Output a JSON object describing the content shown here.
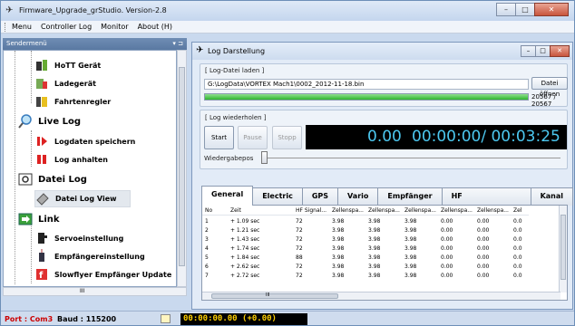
{
  "app": {
    "title": "Firmware_Upgrade_grStudio.  Version-2.8"
  },
  "window_buttons": {
    "minimize": "–",
    "maximize": "□",
    "close": "✕"
  },
  "menu": [
    "Menu",
    "Controller Log",
    "Monitor",
    "About (H)"
  ],
  "sidebar": {
    "header": "Sendermenü",
    "pin": "▾ ⊐",
    "items": [
      {
        "label": "HoTT Gerät",
        "icon": "hott-device-icon",
        "level": 2
      },
      {
        "label": "Ladegerät",
        "icon": "charger-icon",
        "level": 2
      },
      {
        "label": "Fahrtenregler",
        "icon": "speed-controller-icon",
        "level": 2
      },
      {
        "label": "Live Log",
        "icon": "magnifier-icon",
        "level": 1
      },
      {
        "label": "Logdaten speichern",
        "icon": "record-icon",
        "level": 2
      },
      {
        "label": "Log anhalten",
        "icon": "stop-icon",
        "level": 2
      },
      {
        "label": "Datei Log",
        "icon": "file-log-icon",
        "level": 1
      },
      {
        "label": "Datei Log View",
        "icon": "file-view-icon",
        "level": 2,
        "selected": true
      },
      {
        "label": "Link",
        "icon": "link-arrow-icon",
        "level": 1
      },
      {
        "label": "Servoeinstellung",
        "icon": "servo-icon",
        "level": 2
      },
      {
        "label": "Empfängereinstellung",
        "icon": "receiver-icon",
        "level": 2
      },
      {
        "label": "Slowflyer Empfänger Update",
        "icon": "update-icon",
        "level": 2
      }
    ],
    "hscroll_thumb": "III"
  },
  "status": {
    "port": "Port : Com3",
    "baud": "Baud : 115200",
    "time": "00:00:00.00   (+0.00)"
  },
  "child": {
    "title": "Log Darstellung",
    "load_group": "[ Log-Datei laden ]",
    "file_path": "G:\\LogData\\VORTEX Mach1\\0002_2012-11-18.bin",
    "open_button": "Datei öffnen",
    "progress_text": "20567 / 20567",
    "progress_fraction": 1.0,
    "replay_group": "[ Log wiederholen ]",
    "start": "Start",
    "pause": "Pause",
    "stop": "Stopp",
    "value": "0.00",
    "time": "00:00:00/ 00:03:25",
    "playpos_label": "Wiedergabepos",
    "tabs": [
      "General",
      "Electric",
      "GPS",
      "Vario",
      "Empfänger",
      "HF Signalqualität",
      "Kanal"
    ],
    "table": {
      "headers": [
        "No",
        "Zeit",
        "HF Signal...",
        "Zellenspa...",
        "Zellenspa...",
        "Zellenspa...",
        "Zellenspa...",
        "Zellenspa...",
        "Zel"
      ],
      "rows": [
        [
          "1",
          "+ 1.09 sec",
          "72",
          "3.98",
          "3.98",
          "3.98",
          "0.00",
          "0.00",
          "0.0"
        ],
        [
          "2",
          "+ 1.21 sec",
          "72",
          "3.98",
          "3.98",
          "3.98",
          "0.00",
          "0.00",
          "0.0"
        ],
        [
          "3",
          "+ 1.43 sec",
          "72",
          "3.98",
          "3.98",
          "3.98",
          "0.00",
          "0.00",
          "0.0"
        ],
        [
          "4",
          "+ 1.74 sec",
          "72",
          "3.98",
          "3.98",
          "3.98",
          "0.00",
          "0.00",
          "0.0"
        ],
        [
          "5",
          "+ 1.84 sec",
          "88",
          "3.98",
          "3.98",
          "3.98",
          "0.00",
          "0.00",
          "0.0"
        ],
        [
          "6",
          "+ 2.62 sec",
          "72",
          "3.98",
          "3.98",
          "3.98",
          "0.00",
          "0.00",
          "0.0"
        ],
        [
          "7",
          "+ 2.72 sec",
          "72",
          "3.98",
          "3.98",
          "3.98",
          "0.00",
          "0.00",
          "0.0"
        ]
      ]
    },
    "hscroll_thumb": "III"
  },
  "colors": {
    "accent": "#5a79a2",
    "lcd_text": "#4cc8f0",
    "status_time": "#ffd000",
    "port": "#cc0000",
    "progress": "#2fb52f"
  }
}
